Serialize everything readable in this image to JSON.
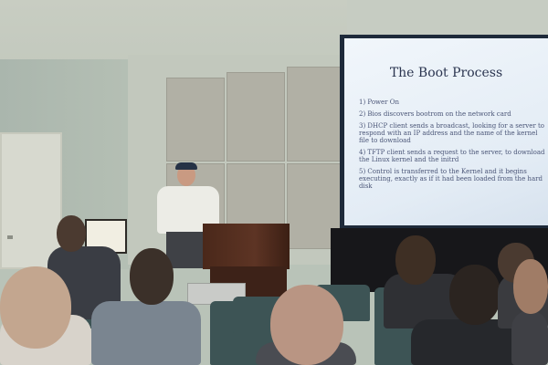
{
  "slide": {
    "title": "The Boot Process",
    "items": [
      "1) Power On",
      "2) Bios discovers bootrom on the network card",
      "3) DHCP client sends a broadcast, looking for a server to respond with an IP address and the name of the kernel file to download",
      "4) TFTP client sends a request to the server, to download the Linux kernel and the initrd",
      "5) Control is transferred to the Kernel and it begins executing, exactly as if it had been loaded from the hard disk"
    ]
  },
  "colors": {
    "slide_background": "#eef4fa",
    "slide_text": "#4a5577",
    "podium": "#5d3424",
    "wall": "#c2c8bd"
  }
}
